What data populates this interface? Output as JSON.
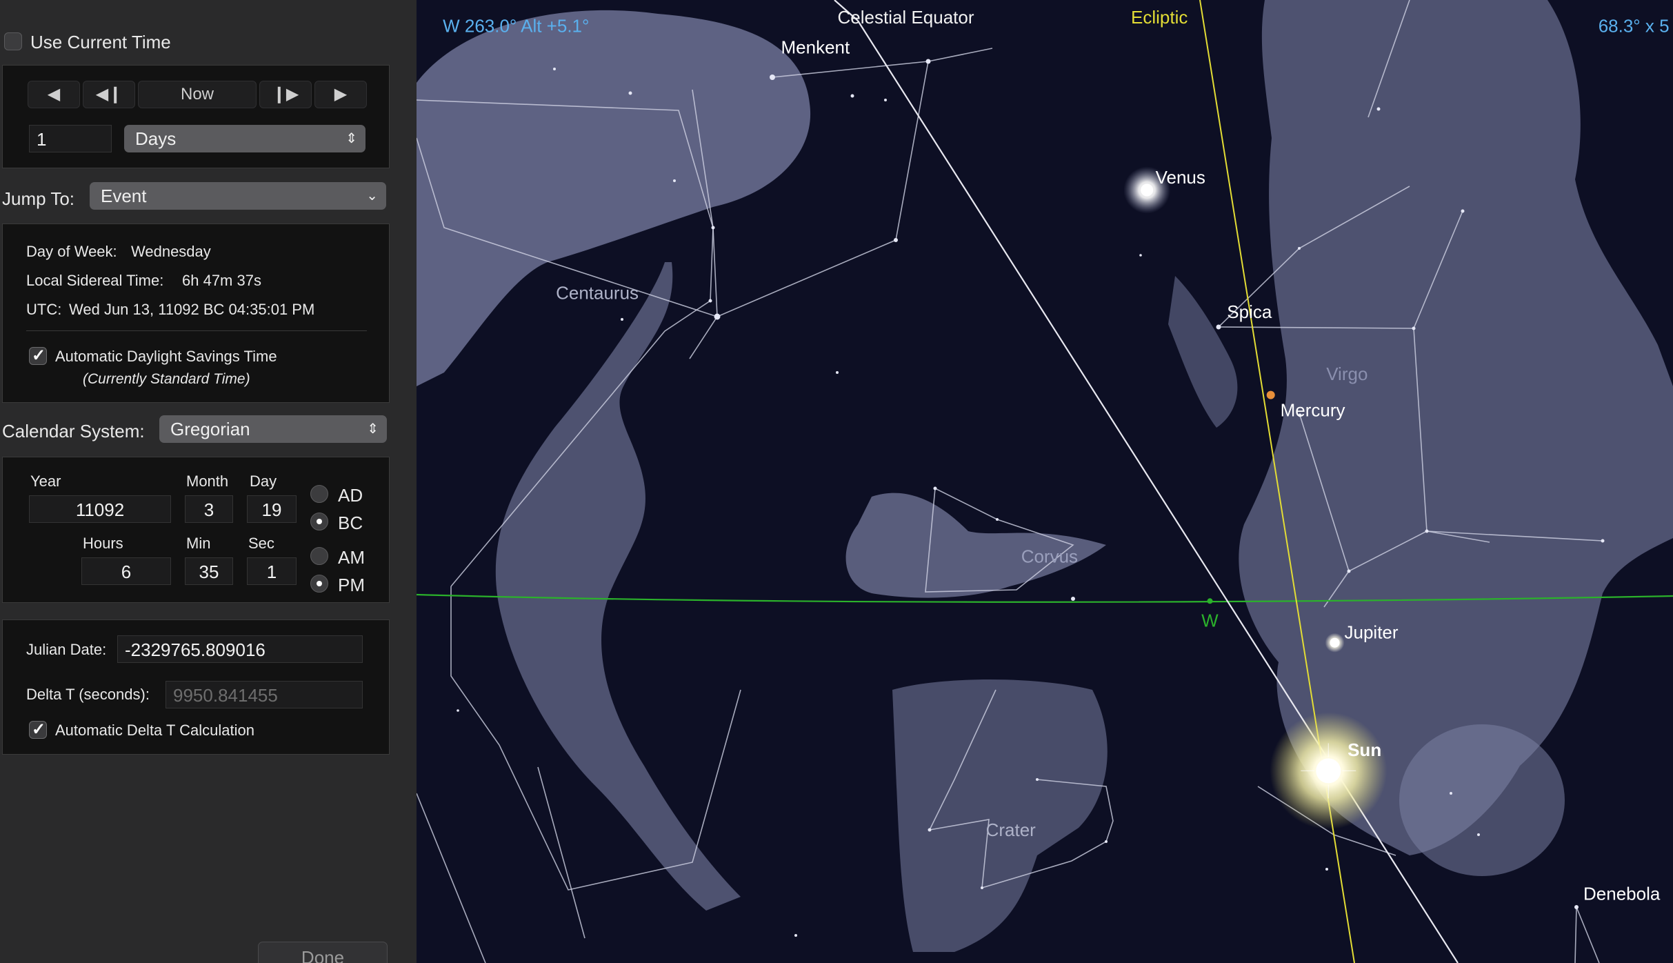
{
  "time_panel": {
    "use_current_time_label": "Use Current Time",
    "use_current_time_checked": false,
    "now_label": "Now",
    "step_value": "1",
    "step_unit": "Days",
    "jump_to_label": "Jump To:",
    "jump_to_value": "Event"
  },
  "info": {
    "day_of_week_label": "Day of Week:",
    "day_of_week_value": "Wednesday",
    "lst_label": "Local Sidereal Time:",
    "lst_value": "6h 47m 37s",
    "utc_label": "UTC:",
    "utc_value": "Wed Jun 13, 11092 BC 04:35:01 PM",
    "dst_label": "Automatic Daylight Savings Time",
    "dst_checked": true,
    "dst_status": "(Currently Standard Time)"
  },
  "calendar": {
    "label": "Calendar System:",
    "value": "Gregorian"
  },
  "date": {
    "year_label": "Year",
    "year": "11092",
    "month_label": "Month",
    "month": "3",
    "day_label": "Day",
    "day": "19",
    "hours_label": "Hours",
    "hours": "6",
    "min_label": "Min",
    "min": "35",
    "sec_label": "Sec",
    "sec": "1",
    "ad_label": "AD",
    "bc_label": "BC",
    "am_label": "AM",
    "pm_label": "PM",
    "era": "BC",
    "meridiem": "PM"
  },
  "julian": {
    "jd_label": "Julian Date:",
    "jd_value": "-2329765.809016",
    "delta_t_label": "Delta T (seconds):",
    "delta_t_value": "9950.841455",
    "auto_delta_t_label": "Automatic Delta T Calculation",
    "auto_delta_t_checked": true
  },
  "done_label": "Done",
  "sky": {
    "view_direction": "W 263.0° Alt +5.1°",
    "zoom": "68.3° x 5",
    "celestial_equator_label": "Celestial Equator",
    "ecliptic_label": "Ecliptic",
    "horizon_cardinal": "W",
    "objects": {
      "menkent": "Menkent",
      "venus": "Venus",
      "spica": "Spica",
      "mercury": "Mercury",
      "jupiter": "Jupiter",
      "sun": "Sun",
      "denebola": "Denebola"
    },
    "constellations": {
      "centaurus": "Centaurus",
      "virgo": "Virgo",
      "corvus": "Corvus",
      "crater": "Crater"
    },
    "colors": {
      "background": "#0d0f24",
      "ecliptic": "#e3dd35",
      "horizon": "#2bb22b",
      "hud": "#5ab0ee"
    }
  }
}
